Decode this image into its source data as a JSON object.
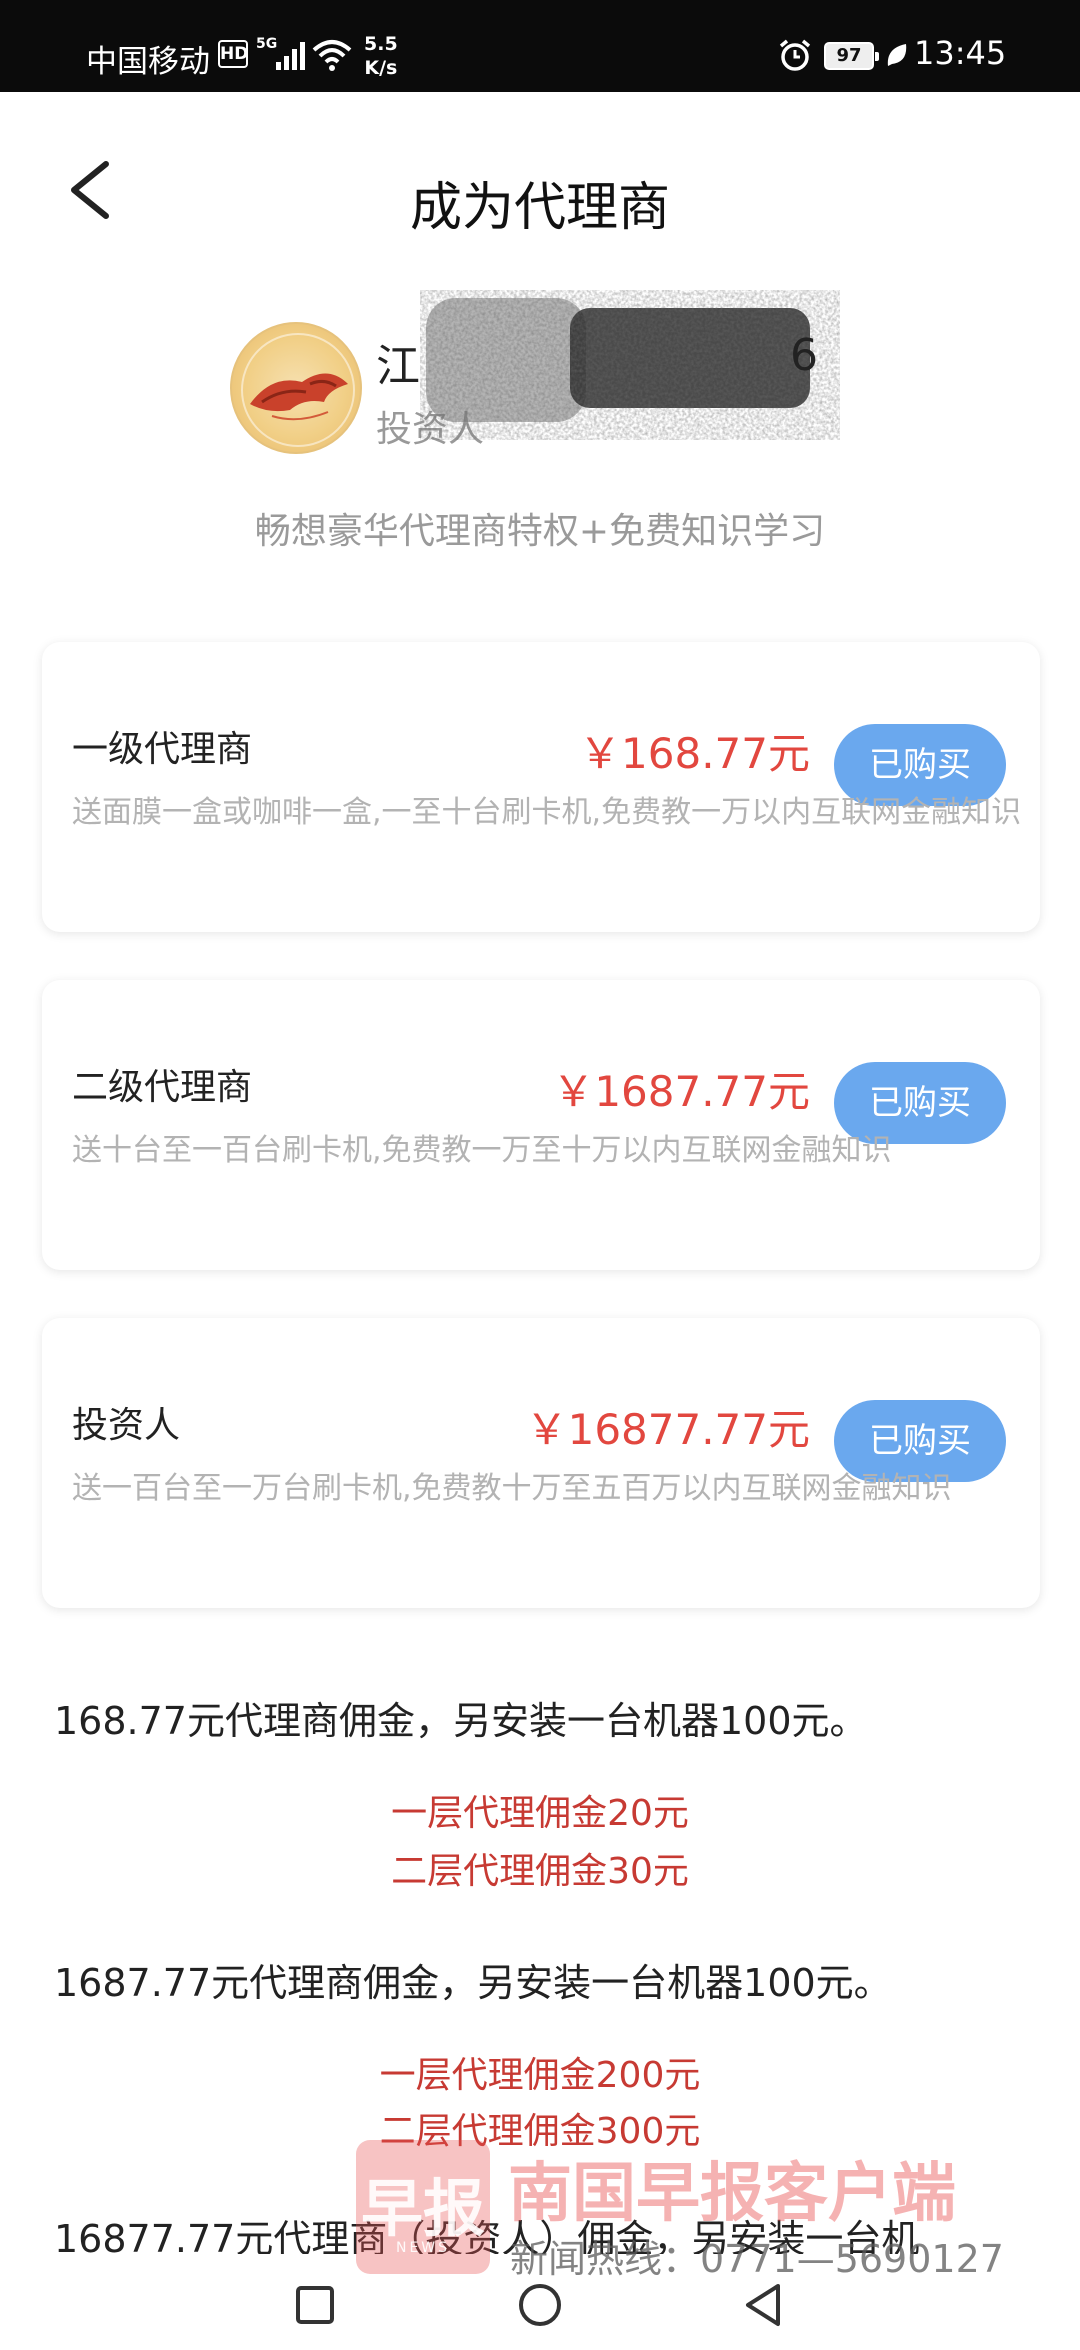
{
  "status_bar": {
    "carrier": "中国移动",
    "hd": "HD",
    "network": "5G",
    "speed_value": "5.5",
    "speed_unit": "K/s",
    "battery": "97",
    "time": "13:45"
  },
  "header": {
    "title": "成为代理商"
  },
  "profile": {
    "name_visible_start": "江",
    "name_visible_end": "6",
    "role": "投资人",
    "slogan": "畅想豪华代理商特权+免费知识学习"
  },
  "agent_levels": [
    {
      "title": "一级代理商",
      "price": "￥168.77元",
      "button": "已购买",
      "description": "送面膜一盒或咖啡一盒,一至十台刷卡机,免费教一万以内互联网金融知识"
    },
    {
      "title": "二级代理商",
      "price": "￥1687.77元",
      "button": "已购买",
      "description": "送十台至一百台刷卡机,免费教一万至十万以内互联网金融知识"
    },
    {
      "title": "投资人",
      "price": "￥16877.77元",
      "button": "已购买",
      "description": "送一百台至一万台刷卡机,免费教十万至五百万以内互联网金融知识"
    }
  ],
  "commission": {
    "block1_text": "168.77元代理商佣金，另安装一台机器100元。",
    "block1_tier1": "一层代理佣金20元",
    "block1_tier2": "二层代理佣金30元",
    "block2_text": "1687.77元代理商佣金，另安装一台机器100元。",
    "block2_tier1": "一层代理佣金200元",
    "block2_tier2": "二层代理佣金300元",
    "block3_text_partial": "16877.77元代理商（投资人）佣金，另安装一台机"
  },
  "watermark": {
    "logo_text": "早报",
    "logo_sub": "NEWS",
    "brand": "南国早报客户端",
    "hotline": "新闻热线：0771—5690127"
  },
  "colors": {
    "price_red": "#e2473f",
    "button_blue": "#6aa8ee",
    "tier_red": "#c73a33"
  },
  "icons": {
    "back": "chevron-left-icon",
    "nav_recent": "square-icon",
    "nav_home": "circle-icon",
    "nav_back": "triangle-back-icon"
  }
}
